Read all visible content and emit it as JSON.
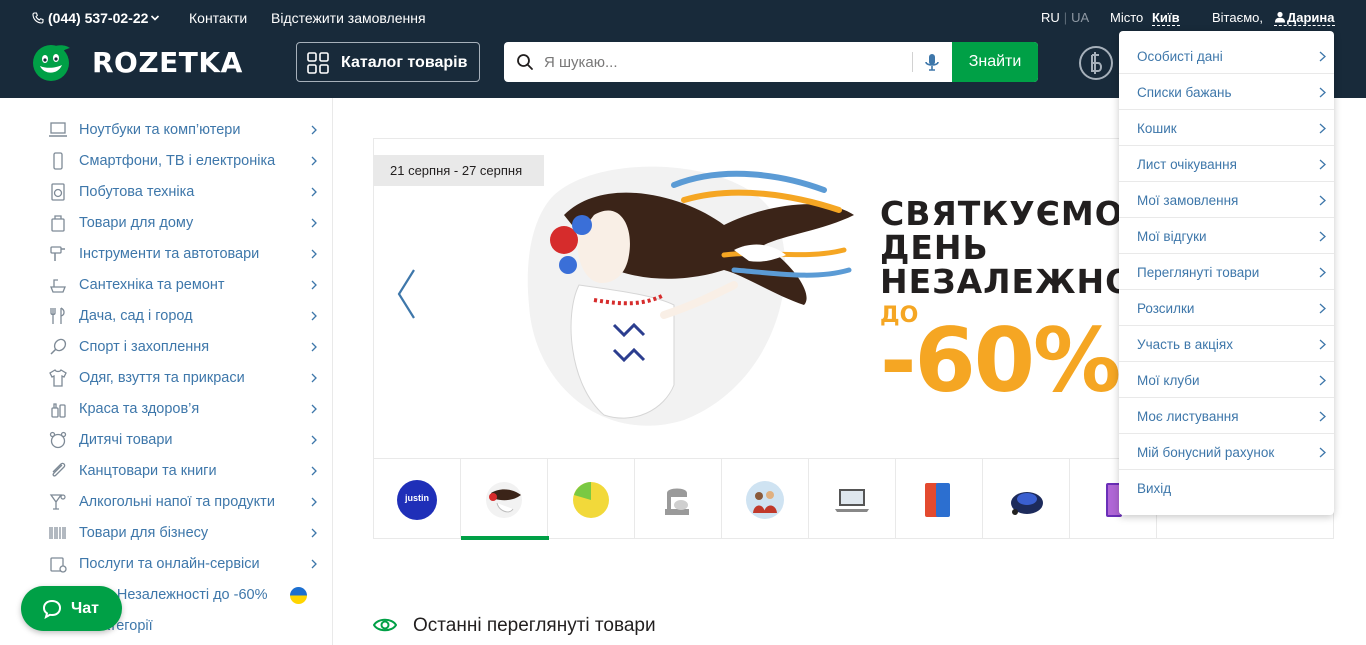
{
  "header": {
    "phone": "(044) 537-02-22",
    "links": {
      "contacts": "Контакти",
      "track": "Відстежити замовлення"
    },
    "lang": {
      "ru": "RU",
      "sep": "|",
      "ua": "UA"
    },
    "city_label": "Місто",
    "city": "Київ",
    "greeting": "Вітаємо,",
    "user_name": "Дарина",
    "logo_text": "ROZETKA",
    "catalog_label": "Каталог товарів",
    "search_placeholder": "Я шукаю...",
    "search_button": "Знайти"
  },
  "sidebar": {
    "items": [
      {
        "label": "Ноутбуки та комп’ютери",
        "icon": "laptop-icon"
      },
      {
        "label": "Смартфони, ТВ і електроніка",
        "icon": "smartphone-icon"
      },
      {
        "label": "Побутова техніка",
        "icon": "washing-machine-icon"
      },
      {
        "label": "Товари для дому",
        "icon": "home-goods-icon"
      },
      {
        "label": "Інструменти та автотовари",
        "icon": "tools-icon"
      },
      {
        "label": "Сантехніка та ремонт",
        "icon": "plumbing-icon"
      },
      {
        "label": "Дача, сад і город",
        "icon": "garden-icon"
      },
      {
        "label": "Спорт і захоплення",
        "icon": "sport-icon"
      },
      {
        "label": "Одяг, взуття та прикраси",
        "icon": "clothes-icon"
      },
      {
        "label": "Краса та здоров’я",
        "icon": "beauty-icon"
      },
      {
        "label": "Дитячі товари",
        "icon": "kids-icon"
      },
      {
        "label": "Канцтовари та книги",
        "icon": "stationery-icon"
      },
      {
        "label": "Алкогольні напої та продукти",
        "icon": "drinks-icon"
      },
      {
        "label": "Товари для бізнесу",
        "icon": "barcode-icon"
      },
      {
        "label": "Послуги та онлайн-сервіси",
        "icon": "services-icon"
      },
      {
        "label": "я Незалежності до -60%",
        "icon": "ukraine-flag-icon"
      },
      {
        "label": "атегорії",
        "icon": "categories-icon"
      }
    ]
  },
  "banner": {
    "date_range": "21 серпня - 27 серпня",
    "line1": "СВЯТКУЄМО",
    "line2": "ДЕНЬ",
    "line3": "НЕЗАЛЕЖНО",
    "prefix": "ДО",
    "discount": "-60%",
    "thumb_justin": "justin"
  },
  "recent": {
    "title": "Останні переглянуті товари"
  },
  "account_menu": {
    "items": [
      "Особисті дані",
      "Списки бажань",
      "Кошик",
      "Лист очікування",
      "Мої замовлення",
      "Мої відгуки",
      "Переглянуті товари",
      "Розсилки",
      "Участь в акціях",
      "Мої клуби",
      "Моє листування",
      "Мій бонусний рахунок",
      "Вихід"
    ]
  },
  "chat": {
    "label": "Чат"
  },
  "colors": {
    "header_bg": "#182a3a",
    "accent_green": "#00a046",
    "link_blue": "#3e77aa",
    "promo_orange": "#f5a623"
  }
}
